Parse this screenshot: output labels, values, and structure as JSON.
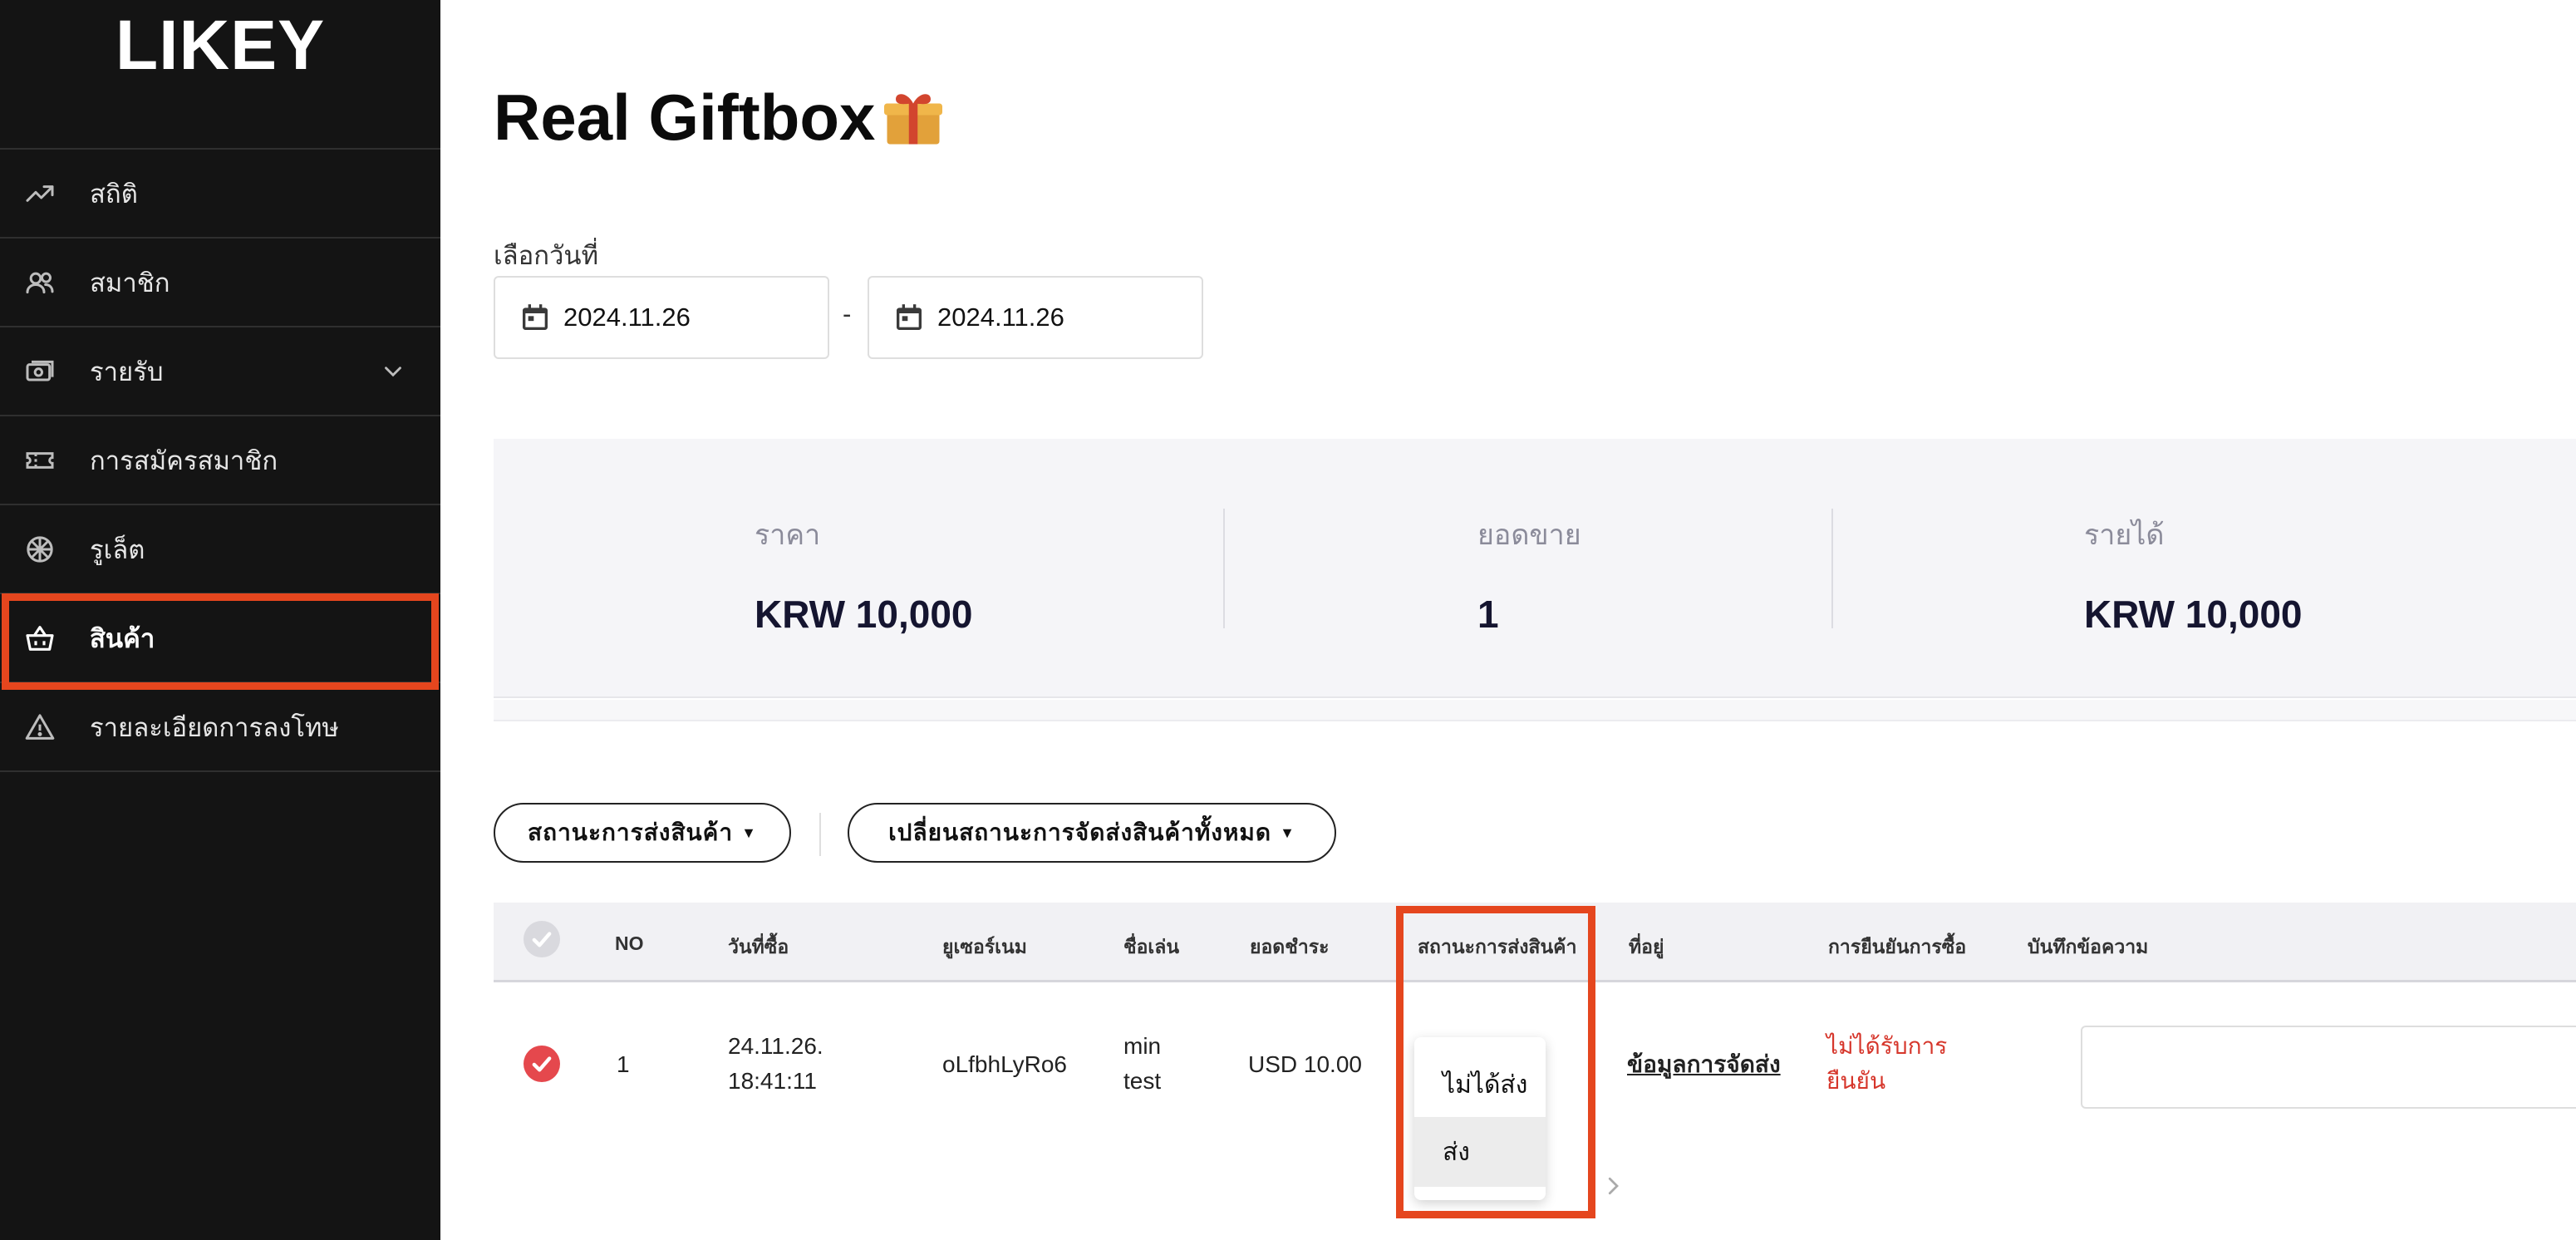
{
  "app": {
    "logo": "LIKEY"
  },
  "sidebar": {
    "items": [
      {
        "label": "สถิติ",
        "icon": "trend-up-icon"
      },
      {
        "label": "สมาชิก",
        "icon": "users-icon"
      },
      {
        "label": "รายรับ",
        "icon": "money-icon",
        "expandable": true
      },
      {
        "label": "การสมัครสมาชิก",
        "icon": "ticket-icon"
      },
      {
        "label": "รูเล็ต",
        "icon": "roulette-icon"
      },
      {
        "label": "สินค้า",
        "icon": "basket-icon",
        "active": true
      },
      {
        "label": "รายละเอียดการลงโทษ",
        "icon": "warning-icon"
      }
    ],
    "highlight_color": "#e5461e"
  },
  "page": {
    "title": "Real Giftbox",
    "title_icon": "gift-icon"
  },
  "date_filter": {
    "label": "เลือกวันที่",
    "start": "2024.11.26",
    "end": "2024.11.26",
    "separator": "-"
  },
  "stats": {
    "price": {
      "label": "ราคา",
      "value": "KRW 10,000"
    },
    "sales": {
      "label": "ยอดขาย",
      "value": "1"
    },
    "revenue": {
      "label": "รายได้",
      "value": "KRW 10,000"
    }
  },
  "filters": {
    "shipping_status": "สถานะการส่งสินค้า",
    "change_all_status": "เปลี่ยนสถานะการจัดส่งสินค้าทั้งหมด",
    "dropdown_marker": "▼"
  },
  "table": {
    "headers": {
      "no": "NO",
      "purchase_date": "วันที่ซื้อ",
      "username": "ยูเซอร์เนม",
      "nickname": "ชื่อเล่น",
      "amount": "ยอดชำระ",
      "shipping_status": "สถานะการส่งสินค้า",
      "address": "ที่อยู่",
      "purchase_confirmation": "การยืนยันการซื้อ",
      "memo": "บันทึกข้อความ"
    },
    "rows": [
      {
        "no": "1",
        "date_line1": "24.11.26.",
        "date_line2": "18:41:11",
        "username": "oLfbhLyRo6",
        "nickname_line1": "min",
        "nickname_line2": "test",
        "amount": "USD 10.00",
        "address_link": "ข้อมูลการจัดส่ง",
        "confirm_line1": "ไม่ได้รับการ",
        "confirm_line2": "ยืนยัน",
        "memo": "",
        "checked": true
      }
    ]
  },
  "status_dropdown": {
    "options": [
      "ไม่ได้ส่ง",
      "ส่ง"
    ],
    "selected": "ส่ง"
  },
  "colors": {
    "sidebar_bg": "#141414",
    "accent_red": "#e5461e",
    "check_red": "#e5484d",
    "unconfirmed_red": "#d6362b"
  }
}
